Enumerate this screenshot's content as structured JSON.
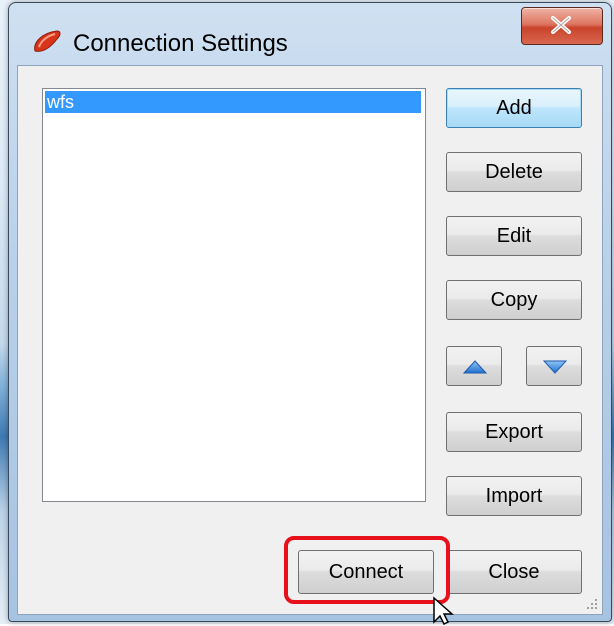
{
  "window": {
    "title": "Connection Settings"
  },
  "connections": {
    "items": [
      {
        "label": "wfs",
        "selected": true
      }
    ]
  },
  "buttons": {
    "add": "Add",
    "delete": "Delete",
    "edit": "Edit",
    "copy": "Copy",
    "export": "Export",
    "import": "Import",
    "connect": "Connect",
    "close": "Close"
  },
  "icons": {
    "app": "flame-icon",
    "close": "close-x-icon",
    "move_up": "triangle-up-icon",
    "move_down": "triangle-down-icon"
  },
  "colors": {
    "selection": "#3399ff",
    "highlight_annotation": "#e8101a",
    "close_button": "#c9432b"
  }
}
